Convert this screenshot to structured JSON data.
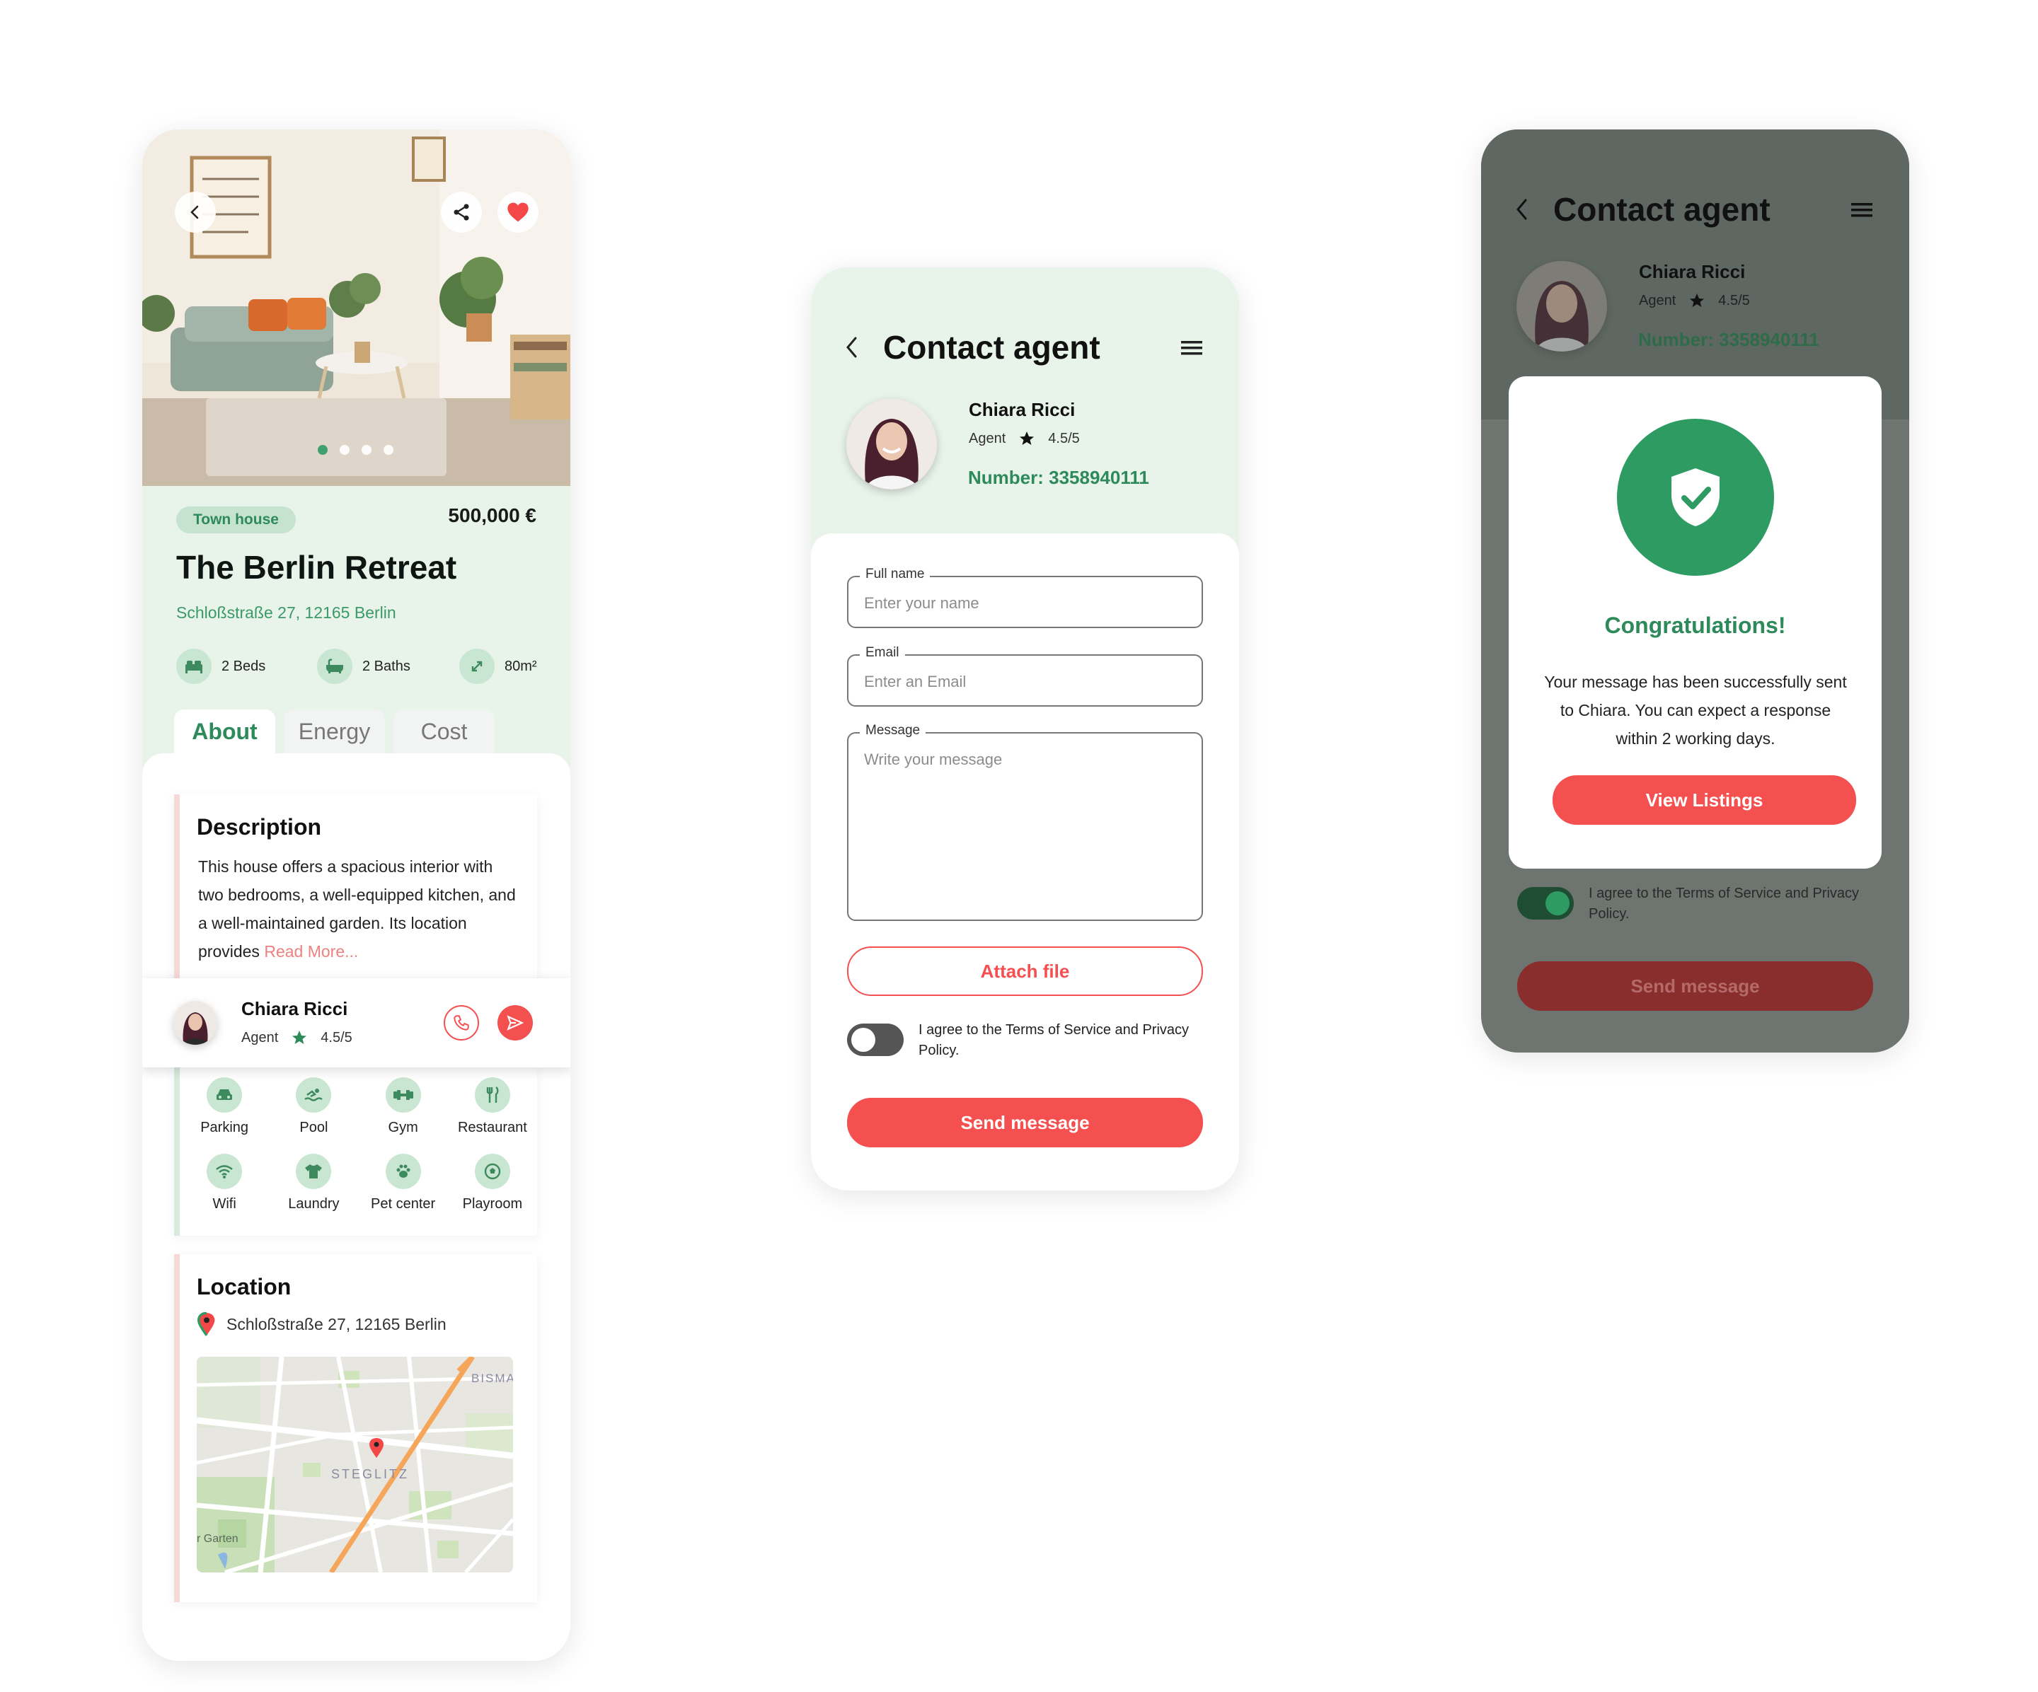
{
  "colors": {
    "brand_green": "#2e9b63",
    "light_green": "#e8f3ea",
    "accent_red": "#f45050",
    "overlay_gray": "#6e746f"
  },
  "listing": {
    "type_chip": "Town house",
    "price": "500,000 €",
    "title": "The Berlin Retreat",
    "address": "Schloßstraße 27, 12165 Berlin",
    "carousel_dots": 4,
    "features": [
      {
        "icon": "bed-icon",
        "label": "2 Beds"
      },
      {
        "icon": "bathtub-icon",
        "label": "2 Baths"
      },
      {
        "icon": "expand-icon",
        "label": "80m²"
      }
    ],
    "tabs": [
      "About",
      "Energy",
      "Cost"
    ],
    "description": {
      "title": "Description",
      "text": "This house  offers a spacious interior with two bedrooms, a well-equipped kitchen, and a well-maintained garden. Its location provides",
      "read_more": "Read More..."
    },
    "agent": {
      "name": "Chiara Ricci",
      "role": "Agent",
      "rating": "4.5/5"
    },
    "amenities": [
      {
        "icon": "car-icon",
        "label": "Parking"
      },
      {
        "icon": "swim-icon",
        "label": "Pool"
      },
      {
        "icon": "dumbbell-icon",
        "label": "Gym"
      },
      {
        "icon": "cutlery-icon",
        "label": "Restaurant"
      },
      {
        "icon": "wifi-icon",
        "label": "Wifi"
      },
      {
        "icon": "shirt-icon",
        "label": "Laundry"
      },
      {
        "icon": "paw-icon",
        "label": "Pet center"
      },
      {
        "icon": "ball-icon",
        "label": "Playroom"
      }
    ],
    "location": {
      "title": "Location",
      "address": "Schloßstraße 27, 12165 Berlin",
      "map_labels": [
        "BISMA",
        "STEGLITZ",
        "r Garten"
      ]
    }
  },
  "contact": {
    "title": "Contact agent",
    "agent_name": "Chiara Ricci",
    "agent_role": "Agent",
    "agent_rating": "4.5/5",
    "agent_number": "Number: 3358940111",
    "fields": {
      "name_label": "Full name",
      "name_placeholder": "Enter your name",
      "email_label": "Email",
      "email_placeholder": "Enter an Email",
      "message_label": "Message",
      "message_placeholder": "Write your message"
    },
    "attach_label": "Attach file",
    "terms": "I agree to the Terms of Service and Privacy Policy.",
    "send_label": "Send message"
  },
  "success": {
    "title": "Contact agent",
    "agent_name": "Chiara Ricci",
    "agent_role": "Agent",
    "agent_rating": "4.5/5",
    "agent_number": "Number: 3358940111",
    "heading": "Congratulations!",
    "message": "Your message has been successfully sent to Chiara. You can expect a response within 2 working days.",
    "view_listings_label": "View Listings",
    "terms": "I agree to the Terms of Service and Privacy Policy.",
    "send_label": "Send message"
  }
}
